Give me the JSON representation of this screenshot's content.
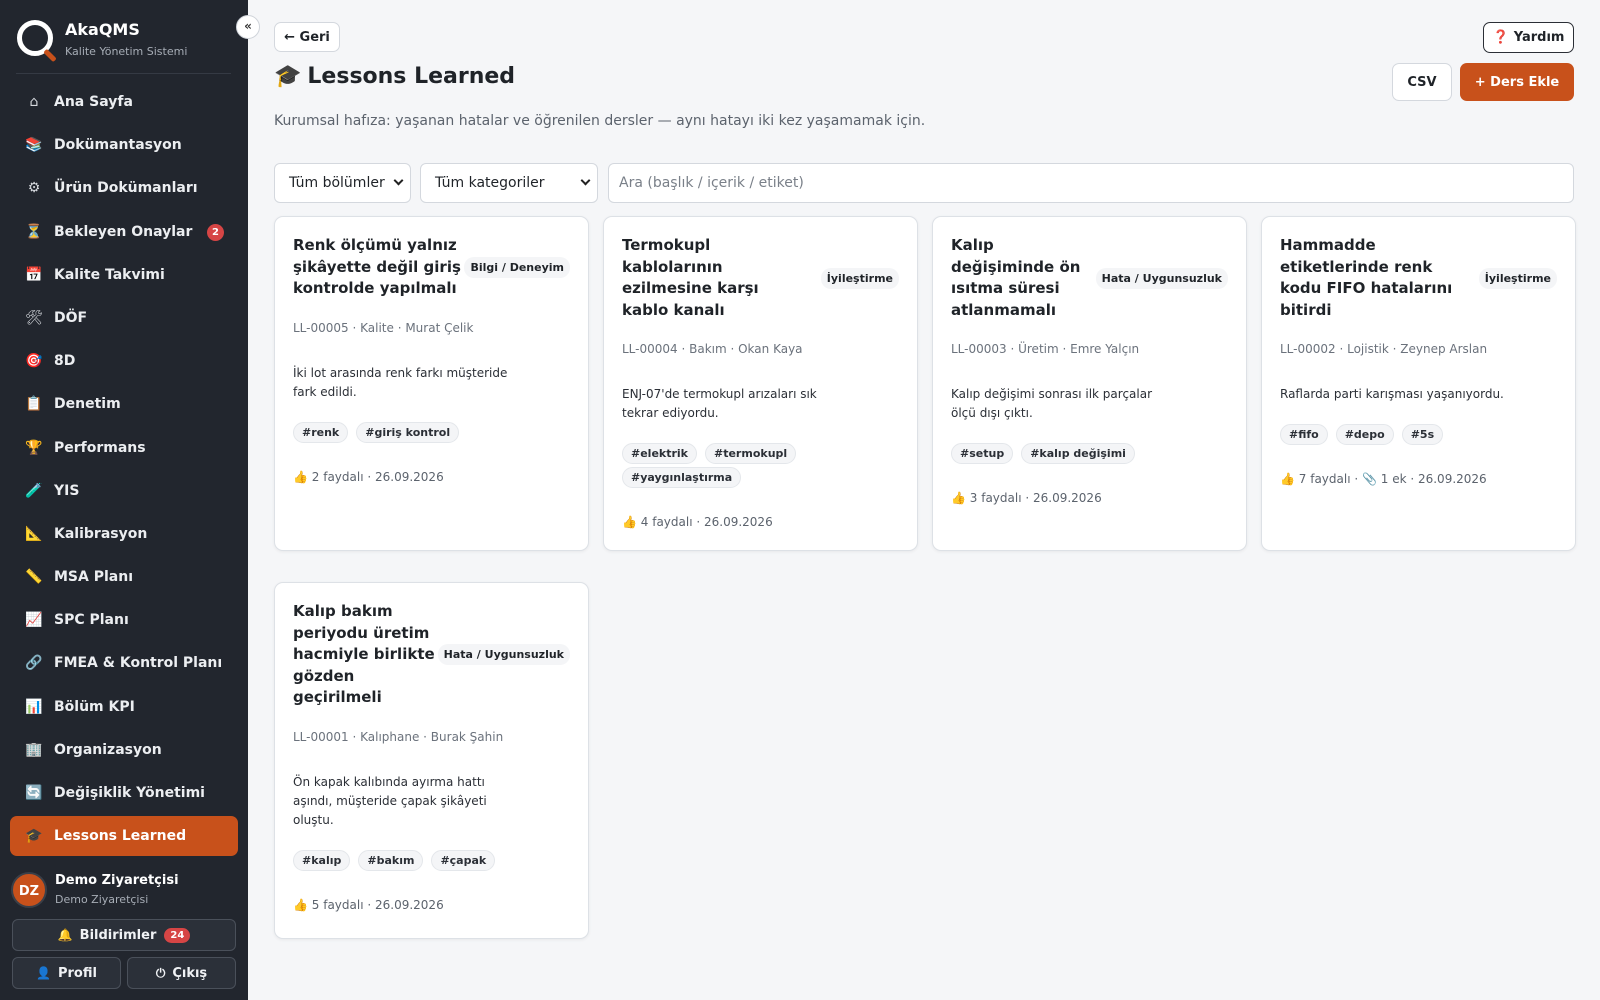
{
  "app": {
    "name": "AkaQMS",
    "subtitle": "Kalite Yönetim Sistemi",
    "collapse_label": "«"
  },
  "sidebar": {
    "items": [
      {
        "icon": "⌂",
        "icon_name": "home-icon",
        "label": "Ana Sayfa"
      },
      {
        "icon": "📚",
        "icon_name": "books-icon",
        "label": "Dokümantasyon"
      },
      {
        "icon": "⚙",
        "icon_name": "gear-icon",
        "label": "Ürün Dokümanları"
      },
      {
        "icon": "⏳",
        "icon_name": "hourglass-icon",
        "label": "Bekleyen Onaylar",
        "badge": "2"
      },
      {
        "icon": "📅",
        "icon_name": "calendar-icon",
        "label": "Kalite Takvimi"
      },
      {
        "icon": "🛠",
        "icon_name": "tools-icon",
        "label": "DÖF"
      },
      {
        "icon": "🎯",
        "icon_name": "target-icon",
        "label": "8D"
      },
      {
        "icon": "📋",
        "icon_name": "clipboard-icon",
        "label": "Denetim"
      },
      {
        "icon": "🏆",
        "icon_name": "trophy-icon",
        "label": "Performans"
      },
      {
        "icon": "🧪",
        "icon_name": "test-tube-icon",
        "label": "YIS"
      },
      {
        "icon": "📐",
        "icon_name": "triangle-ruler-icon",
        "label": "Kalibrasyon"
      },
      {
        "icon": "📏",
        "icon_name": "ruler-icon",
        "label": "MSA Planı"
      },
      {
        "icon": "📈",
        "icon_name": "chart-icon",
        "label": "SPC Planı"
      },
      {
        "icon": "🔗",
        "icon_name": "link-icon",
        "label": "FMEA & Kontrol Planı"
      },
      {
        "icon": "📊",
        "icon_name": "bar-chart-icon",
        "label": "Bölüm KPI"
      },
      {
        "icon": "🏢",
        "icon_name": "building-icon",
        "label": "Organizasyon"
      },
      {
        "icon": "🔄",
        "icon_name": "cycle-icon",
        "label": "Değişiklik Yönetimi"
      },
      {
        "icon": "🎓",
        "icon_name": "graduation-cap-icon",
        "label": "Lessons Learned",
        "active": true
      }
    ]
  },
  "user": {
    "initials": "DZ",
    "name": "Demo Ziyaretçisi",
    "role": "Demo Ziyaretçisi"
  },
  "footer_buttons": {
    "notifications_label": "Bildirimler",
    "notifications_count": "24",
    "profile_label": "Profil",
    "logout_label": "Çıkış"
  },
  "header": {
    "back_label": "← Geri",
    "help_label": "Yardım",
    "title": "Lessons Learned",
    "csv_label": "CSV",
    "add_label": "+ Ders Ekle",
    "subtitle": "Kurumsal hafıza: yaşanan hatalar ve öğrenilen dersler — aynı hatayı iki kez yaşamamak için."
  },
  "filters": {
    "department": "Tüm bölümler",
    "category": "Tüm kategoriler",
    "search_placeholder": "Ara (başlık / içerik / etiket)"
  },
  "lessons": [
    {
      "title": "Renk ölçümü yalnız şikâyette değil giriş kontrolde yapılmalı",
      "category": "Bilgi / Deneyim",
      "meta": "LL-00005 · Kalite · Murat Çelik",
      "description": "İki lot arasında renk farkı müşteride fark edildi.",
      "tags": [
        "#renk",
        "#giriş kontrol"
      ],
      "footer": "2 faydalı · 26.09.2026"
    },
    {
      "title": "Termokupl kablolarının ezilmesine karşı kablo kanalı",
      "category": "İyileştirme",
      "meta": "LL-00004 · Bakım · Okan Kaya",
      "description": "ENJ-07'de termokupl arızaları sık tekrar ediyordu.",
      "tags": [
        "#elektrik",
        "#termokupl",
        "#yaygınlaştırma"
      ],
      "footer": "4 faydalı · 26.09.2026"
    },
    {
      "title": "Kalıp değişiminde ön ısıtma süresi atlanmamalı",
      "category": "Hata / Uygunsuzluk",
      "meta": "LL-00003 · Üretim · Emre Yalçın",
      "description": "Kalıp değişimi sonrası ilk parçalar ölçü dışı çıktı.",
      "tags": [
        "#setup",
        "#kalıp değişimi"
      ],
      "footer": "3 faydalı · 26.09.2026"
    },
    {
      "title": "Hammadde etiketlerinde renk kodu FIFO hatalarını bitirdi",
      "category": "İyileştirme",
      "meta": "LL-00002 · Lojistik · Zeynep Arslan",
      "description": "Raflarda parti karışması yaşanıyordu.",
      "tags": [
        "#fifo",
        "#depo",
        "#5s"
      ],
      "footer": "7 faydalı · 📎 1 ek · 26.09.2026"
    },
    {
      "title": "Kalıp bakım periyodu üretim hacmiyle birlikte gözden geçirilmeli",
      "category": "Hata / Uygunsuzluk",
      "meta": "LL-00001 · Kalıphane · Burak Şahin",
      "description": "Ön kapak kalıbında ayırma hattı aşındı, müşteride çapak şikâyeti oluştu.",
      "tags": [
        "#kalıp",
        "#bakım",
        "#çapak"
      ],
      "footer": "5 faydalı · 26.09.2026"
    }
  ]
}
